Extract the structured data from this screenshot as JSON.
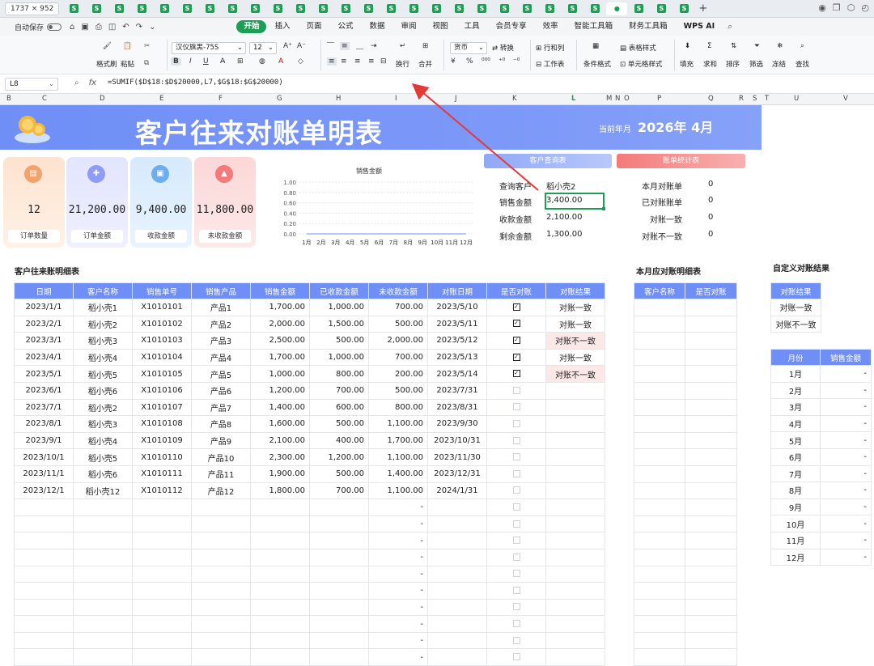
{
  "tabbar": {
    "dimensions": "1737 × 952",
    "tab_icon_letter": "S",
    "active_tab_marker": "●",
    "new_tab": "+",
    "tab_count": 28
  },
  "menubar": {
    "autosave_label": "自动保存",
    "menus": [
      "开始",
      "插入",
      "页面",
      "公式",
      "数据",
      "审阅",
      "视图",
      "工具",
      "会员专享",
      "效率",
      "智能工具箱",
      "财务工具箱",
      "WPS AI"
    ],
    "active_menu": "开始"
  },
  "ribbon": {
    "format_painter": "格式刷",
    "paste": "粘贴",
    "font_name": "汉仪旗黑-75S",
    "font_size": "12",
    "wrap": "换行",
    "merge": "合并",
    "number_format": "货币",
    "convert": "转换",
    "row_col": "行和列",
    "worksheet": "工作表",
    "cond_format": "条件格式",
    "table_style": "表格样式",
    "cell_style": "单元格样式",
    "fill": "填充",
    "sum": "求和",
    "sort": "排序",
    "filter": "筛选",
    "freeze": "冻结",
    "find": "查找"
  },
  "formula_bar": {
    "cell_ref": "L8",
    "fx": "fx",
    "formula": "=SUMIF($D$18:$D$20000,L7,$G$18:$G$20000)"
  },
  "columns": [
    "B",
    "C",
    "D",
    "E",
    "F",
    "G",
    "H",
    "I",
    "J",
    "K",
    "L",
    "M",
    "N",
    "O",
    "P",
    "Q",
    "R",
    "S",
    "T",
    "U",
    "V"
  ],
  "selected_column": "L",
  "banner": {
    "title": "客户往来对账单明表",
    "date_label": "当前年月",
    "date_value": "2026年  4月"
  },
  "kpis": [
    {
      "value": "12",
      "label": "订单数量",
      "icon": "document-icon",
      "color": "#f4a26b"
    },
    {
      "value": "21,200.00",
      "label": "订单金额",
      "icon": "grid-icon",
      "color": "#8f9cf7"
    },
    {
      "value": "9,400.00",
      "label": "收款金额",
      "icon": "file-icon",
      "color": "#6aaef0"
    },
    {
      "value": "11,800.00",
      "label": "未收款金额",
      "icon": "flame-icon",
      "color": "#f47a7a"
    }
  ],
  "chart_data": {
    "type": "line",
    "title": "销售金额",
    "categories": [
      "1月",
      "2月",
      "3月",
      "4月",
      "5月",
      "6月",
      "7月",
      "8月",
      "9月",
      "10月",
      "11月",
      "12月"
    ],
    "values": [
      0,
      0,
      0,
      0,
      0,
      0,
      0,
      0,
      0,
      0,
      0,
      0
    ],
    "yticks": [
      "1.00",
      "0.80",
      "0.60",
      "0.40",
      "0.20",
      "0.00"
    ],
    "ylim": [
      0,
      1
    ],
    "grid": true
  },
  "query": {
    "title": "客户查询表",
    "rows": [
      {
        "label": "查询客户",
        "value": "稻小壳2"
      },
      {
        "label": "销售金额",
        "value": "3,400.00"
      },
      {
        "label": "收款金额",
        "value": "2,100.00"
      },
      {
        "label": "剩余金额",
        "value": "1,300.00"
      }
    ]
  },
  "stats": {
    "title": "账单统计表",
    "rows": [
      {
        "label": "本月对账单",
        "value": "0"
      },
      {
        "label": "已对账账单",
        "value": "0"
      },
      {
        "label": "对账一致",
        "value": "0"
      },
      {
        "label": "对账不一致",
        "value": "0"
      }
    ]
  },
  "detail": {
    "title": "客户往来账明细表",
    "headers": [
      "日期",
      "客户名称",
      "销售单号",
      "销售产品",
      "销售金额",
      "已收款金额",
      "未收款金额",
      "对账日期",
      "是否对账",
      "对账结果"
    ],
    "rows": [
      [
        "2023/1/1",
        "稻小壳1",
        "X1010101",
        "产品1",
        "1,700.00",
        "1,000.00",
        "700.00",
        "2023/5/10",
        true,
        "对账一致"
      ],
      [
        "2023/2/1",
        "稻小壳2",
        "X1010102",
        "产品2",
        "2,000.00",
        "1,500.00",
        "500.00",
        "2023/5/11",
        true,
        "对账一致"
      ],
      [
        "2023/3/1",
        "稻小壳3",
        "X1010103",
        "产品3",
        "2,500.00",
        "500.00",
        "2,000.00",
        "2023/5/12",
        true,
        "对账不一致"
      ],
      [
        "2023/4/1",
        "稻小壳4",
        "X1010104",
        "产品4",
        "1,700.00",
        "1,000.00",
        "700.00",
        "2023/5/13",
        true,
        "对账一致"
      ],
      [
        "2023/5/1",
        "稻小壳5",
        "X1010105",
        "产品5",
        "1,000.00",
        "800.00",
        "200.00",
        "2023/5/14",
        true,
        "对账不一致"
      ],
      [
        "2023/6/1",
        "稻小壳6",
        "X1010106",
        "产品6",
        "1,200.00",
        "700.00",
        "500.00",
        "2023/7/31",
        false,
        ""
      ],
      [
        "2023/7/1",
        "稻小壳2",
        "X1010107",
        "产品7",
        "1,400.00",
        "600.00",
        "800.00",
        "2023/8/31",
        false,
        ""
      ],
      [
        "2023/8/1",
        "稻小壳3",
        "X1010108",
        "产品8",
        "1,600.00",
        "500.00",
        "1,100.00",
        "2023/9/30",
        false,
        ""
      ],
      [
        "2023/9/1",
        "稻小壳4",
        "X1010109",
        "产品9",
        "2,100.00",
        "400.00",
        "1,700.00",
        "2023/10/31",
        false,
        ""
      ],
      [
        "2023/10/1",
        "稻小壳5",
        "X1010110",
        "产品10",
        "2,300.00",
        "1,200.00",
        "1,100.00",
        "2023/11/30",
        false,
        ""
      ],
      [
        "2023/11/1",
        "稻小壳6",
        "X1010111",
        "产品11",
        "1,900.00",
        "500.00",
        "1,400.00",
        "2023/12/31",
        false,
        ""
      ],
      [
        "2023/12/1",
        "稻小壳12",
        "X1010112",
        "产品12",
        "1,800.00",
        "700.00",
        "1,100.00",
        "2024/1/31",
        false,
        ""
      ],
      [
        "",
        "",
        "",
        "",
        "",
        "",
        "-",
        "",
        false,
        ""
      ],
      [
        "",
        "",
        "",
        "",
        "",
        "",
        "-",
        "",
        false,
        ""
      ],
      [
        "",
        "",
        "",
        "",
        "",
        "",
        "-",
        "",
        false,
        ""
      ],
      [
        "",
        "",
        "",
        "",
        "",
        "",
        "-",
        "",
        false,
        ""
      ],
      [
        "",
        "",
        "",
        "",
        "",
        "",
        "-",
        "",
        false,
        ""
      ],
      [
        "",
        "",
        "",
        "",
        "",
        "",
        "-",
        "",
        false,
        ""
      ],
      [
        "",
        "",
        "",
        "",
        "",
        "",
        "-",
        "",
        false,
        ""
      ],
      [
        "",
        "",
        "",
        "",
        "",
        "",
        "-",
        "",
        false,
        ""
      ],
      [
        "",
        "",
        "",
        "",
        "",
        "",
        "-",
        "",
        false,
        ""
      ],
      [
        "",
        "",
        "",
        "",
        "",
        "",
        "-",
        "",
        false,
        ""
      ]
    ]
  },
  "monthly": {
    "title": "本月应对账明细表",
    "headers": [
      "客户名称",
      "是否对账"
    ]
  },
  "custom": {
    "title": "自定义对账结果",
    "header": "对账结果",
    "options": [
      "对账一致",
      "对账不一致"
    ]
  },
  "month_sales": {
    "headers": [
      "月份",
      "销售金额"
    ],
    "rows": [
      [
        "1月",
        "-"
      ],
      [
        "2月",
        "-"
      ],
      [
        "3月",
        "-"
      ],
      [
        "4月",
        "-"
      ],
      [
        "5月",
        "-"
      ],
      [
        "6月",
        "-"
      ],
      [
        "7月",
        "-"
      ],
      [
        "8月",
        "-"
      ],
      [
        "9月",
        "-"
      ],
      [
        "10月",
        "-"
      ],
      [
        "11月",
        "-"
      ],
      [
        "12月",
        "-"
      ]
    ]
  },
  "colors": {
    "accent": "#6f8ff7",
    "green": "#1e9e55",
    "stats_header": "#f47a7a",
    "warn_bg": "#fde8e8",
    "arrow": "#e53935"
  }
}
